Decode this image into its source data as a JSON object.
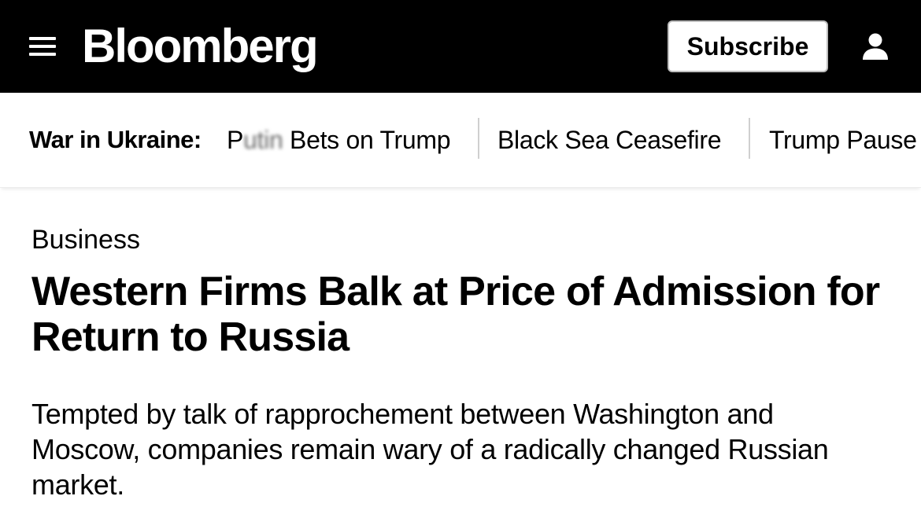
{
  "header": {
    "brand": "Bloomberg",
    "subscribe_label": "Subscribe",
    "icons": {
      "menu": "hamburger-menu-icon",
      "account": "user-icon"
    },
    "background_color": "#000000"
  },
  "topic_bar": {
    "label": "War in Ukraine:",
    "links": [
      {
        "prefix": "P",
        "obscured": "utin",
        "rest": " Bets on Trump"
      },
      {
        "label": "Black Sea Ceasefire"
      },
      {
        "label": "Trump Pause"
      }
    ]
  },
  "article": {
    "category": "Business",
    "headline": "Western Firms Balk at Price of Admission for Return to Russia",
    "dek": "Tempted by talk of rapprochement between Washington and Moscow, companies remain wary of a radically changed Russian market."
  }
}
